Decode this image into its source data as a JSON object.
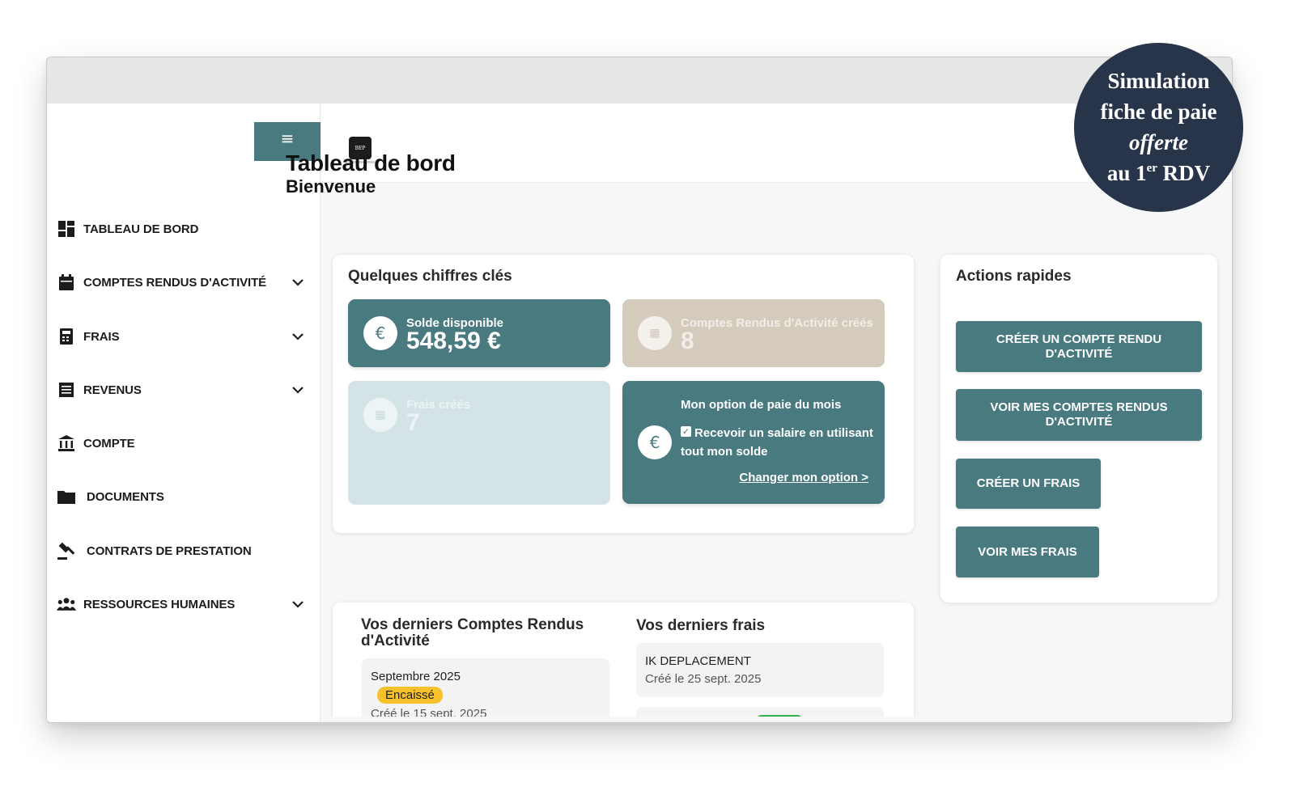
{
  "sidebar": {
    "menu_icon": "hamburger-icon",
    "items": [
      {
        "label": "TABLEAU DE BORD",
        "icon": "dashboard-icon",
        "expandable": false
      },
      {
        "label": "COMPTES RENDUS D'ACTIVITÉ",
        "icon": "calendar-icon",
        "expandable": true
      },
      {
        "label": "FRAIS",
        "icon": "calculator-icon",
        "expandable": true
      },
      {
        "label": "REVENUS",
        "icon": "receipt-icon",
        "expandable": true
      },
      {
        "label": "COMPTE",
        "icon": "bank-icon",
        "expandable": false
      },
      {
        "label": "DOCUMENTS",
        "icon": "folder-icon",
        "expandable": false
      },
      {
        "label": "CONTRATS DE PRESTATION",
        "icon": "gavel-icon",
        "expandable": false
      },
      {
        "label": "RESSOURCES HUMAINES",
        "icon": "people-icon",
        "expandable": true
      }
    ]
  },
  "topbar": {
    "logo_text": "BEP"
  },
  "page": {
    "title": "Tableau de bord",
    "subtitle": "Bienvenue"
  },
  "key_figures": {
    "title": "Quelques chiffres clés",
    "balance": {
      "label": "Solde disponible",
      "value": "548,59 €",
      "icon": "euro-icon"
    },
    "reports": {
      "label": "Comptes Rendus d'Activité créés",
      "value": "8",
      "icon": "calendar-icon"
    },
    "expenses": {
      "label": "Frais créés",
      "value": "7",
      "icon": "calculator-icon"
    },
    "pay_option": {
      "title": "Mon option de paie du mois",
      "text": "Recevoir un salaire en utilisant tout mon solde",
      "checked": true,
      "link": "Changer mon option >",
      "icon": "euro-icon"
    }
  },
  "quick_actions": {
    "title": "Actions rapides",
    "buttons": [
      "CRÉER UN COMPTE RENDU D'ACTIVITÉ",
      "VOIR MES COMPTES RENDUS D'ACTIVITÉ",
      "CRÉER UN FRAIS",
      "VOIR MES FRAIS"
    ]
  },
  "recent": {
    "reports_title": "Vos derniers Comptes Rendus d'Activité",
    "expenses_title": "Vos derniers frais",
    "report_item": {
      "title": "Septembre 2025",
      "status": "Encaissé",
      "date": "Créé le 15 sept. 2025"
    },
    "expense_item": {
      "title": "IK DEPLACEMENT",
      "date": "Créé le 25 sept. 2025"
    }
  },
  "promo": {
    "line1": "Simulation",
    "line2": "fiche de paie",
    "line3": "offerte",
    "line4_prefix": "au 1",
    "line4_sup": "er",
    "line4_suffix": " RDV"
  },
  "colors": {
    "accent": "#487a7f",
    "beige": "#d5cbbd",
    "pale": "#d4e4e6",
    "badge": "#f6c12a",
    "promo_bg": "#27344a"
  }
}
